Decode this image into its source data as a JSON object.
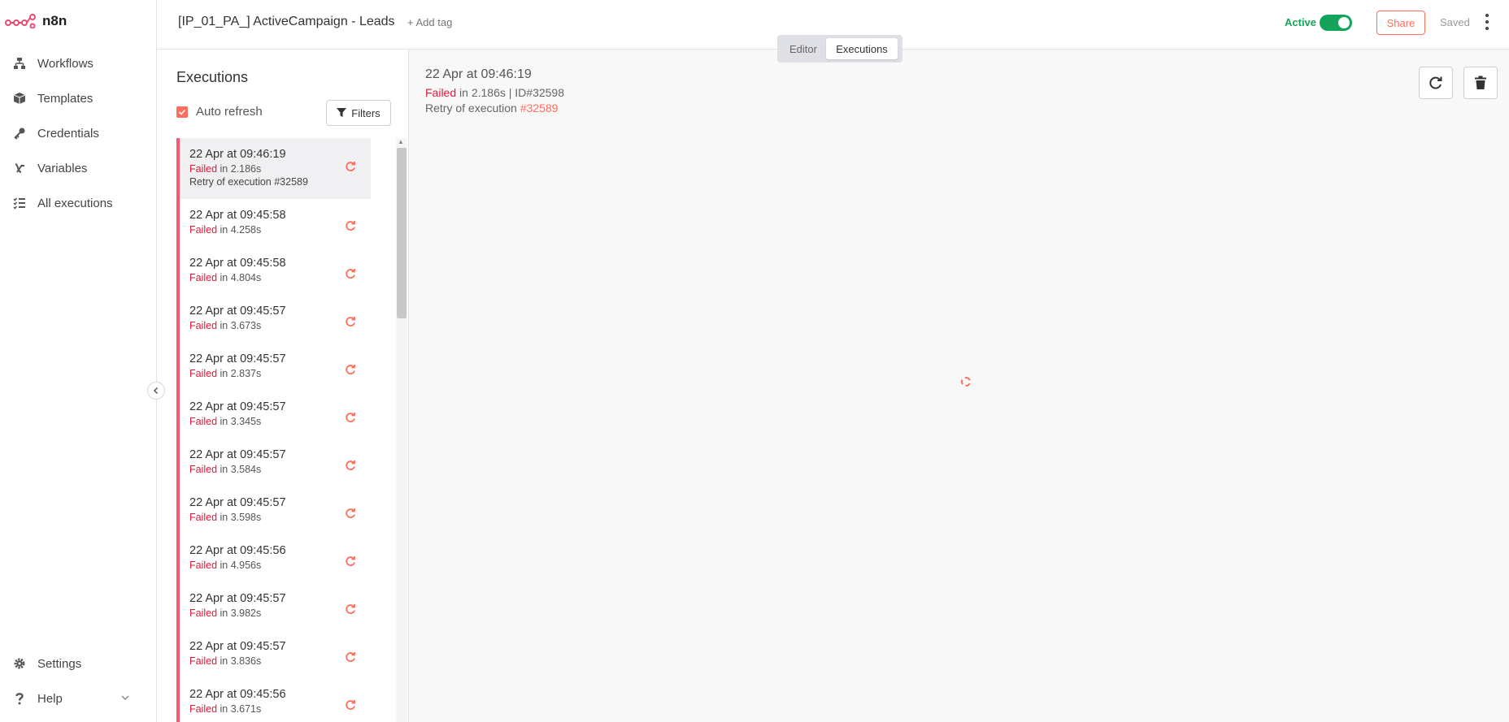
{
  "app": {
    "logo_text": "n8n"
  },
  "sidebar": {
    "items": [
      {
        "label": "Workflows",
        "icon": "network-icon"
      },
      {
        "label": "Templates",
        "icon": "box-icon"
      },
      {
        "label": "Credentials",
        "icon": "key-icon"
      },
      {
        "label": "Variables",
        "icon": "variable-icon"
      },
      {
        "label": "All executions",
        "icon": "tasks-icon"
      }
    ],
    "bottom": [
      {
        "label": "Settings",
        "icon": "gear-icon"
      },
      {
        "label": "Help",
        "icon": "question-icon"
      }
    ]
  },
  "header": {
    "workflow_title": "[IP_01_PA_] ActiveCampaign - Leads",
    "add_tag": "+ Add tag",
    "active_label": "Active",
    "active": true,
    "share_label": "Share",
    "saved_label": "Saved",
    "tabs": {
      "editor": "Editor",
      "executions": "Executions",
      "selected": "Executions"
    }
  },
  "executions_panel": {
    "heading": "Executions",
    "auto_refresh_label": "Auto refresh",
    "auto_refresh_checked": true,
    "filters_label": "Filters",
    "items": [
      {
        "time": "22 Apr at 09:46:19",
        "status": "Failed",
        "duration": "in 2.186s",
        "retry": "Retry of execution #32589",
        "selected": true
      },
      {
        "time": "22 Apr at 09:45:58",
        "status": "Failed",
        "duration": "in 4.258s"
      },
      {
        "time": "22 Apr at 09:45:58",
        "status": "Failed",
        "duration": "in 4.804s"
      },
      {
        "time": "22 Apr at 09:45:57",
        "status": "Failed",
        "duration": "in 3.673s"
      },
      {
        "time": "22 Apr at 09:45:57",
        "status": "Failed",
        "duration": "in 2.837s"
      },
      {
        "time": "22 Apr at 09:45:57",
        "status": "Failed",
        "duration": "in 3.345s"
      },
      {
        "time": "22 Apr at 09:45:57",
        "status": "Failed",
        "duration": "in 3.584s"
      },
      {
        "time": "22 Apr at 09:45:57",
        "status": "Failed",
        "duration": "in 3.598s"
      },
      {
        "time": "22 Apr at 09:45:56",
        "status": "Failed",
        "duration": "in 4.956s"
      },
      {
        "time": "22 Apr at 09:45:57",
        "status": "Failed",
        "duration": "in 3.982s"
      },
      {
        "time": "22 Apr at 09:45:57",
        "status": "Failed",
        "duration": "in 3.836s"
      },
      {
        "time": "22 Apr at 09:45:56",
        "status": "Failed",
        "duration": "in 3.671s"
      }
    ]
  },
  "detail": {
    "time": "22 Apr at 09:46:19",
    "status": "Failed",
    "duration_id": " in 2.186s | ",
    "id_label": "ID#32598",
    "retry_prefix": "Retry of execution ",
    "retry_link": "#32589"
  },
  "colors": {
    "accent": "#ff6d5a",
    "failed": "#e0193a",
    "active": "#13a35a"
  }
}
